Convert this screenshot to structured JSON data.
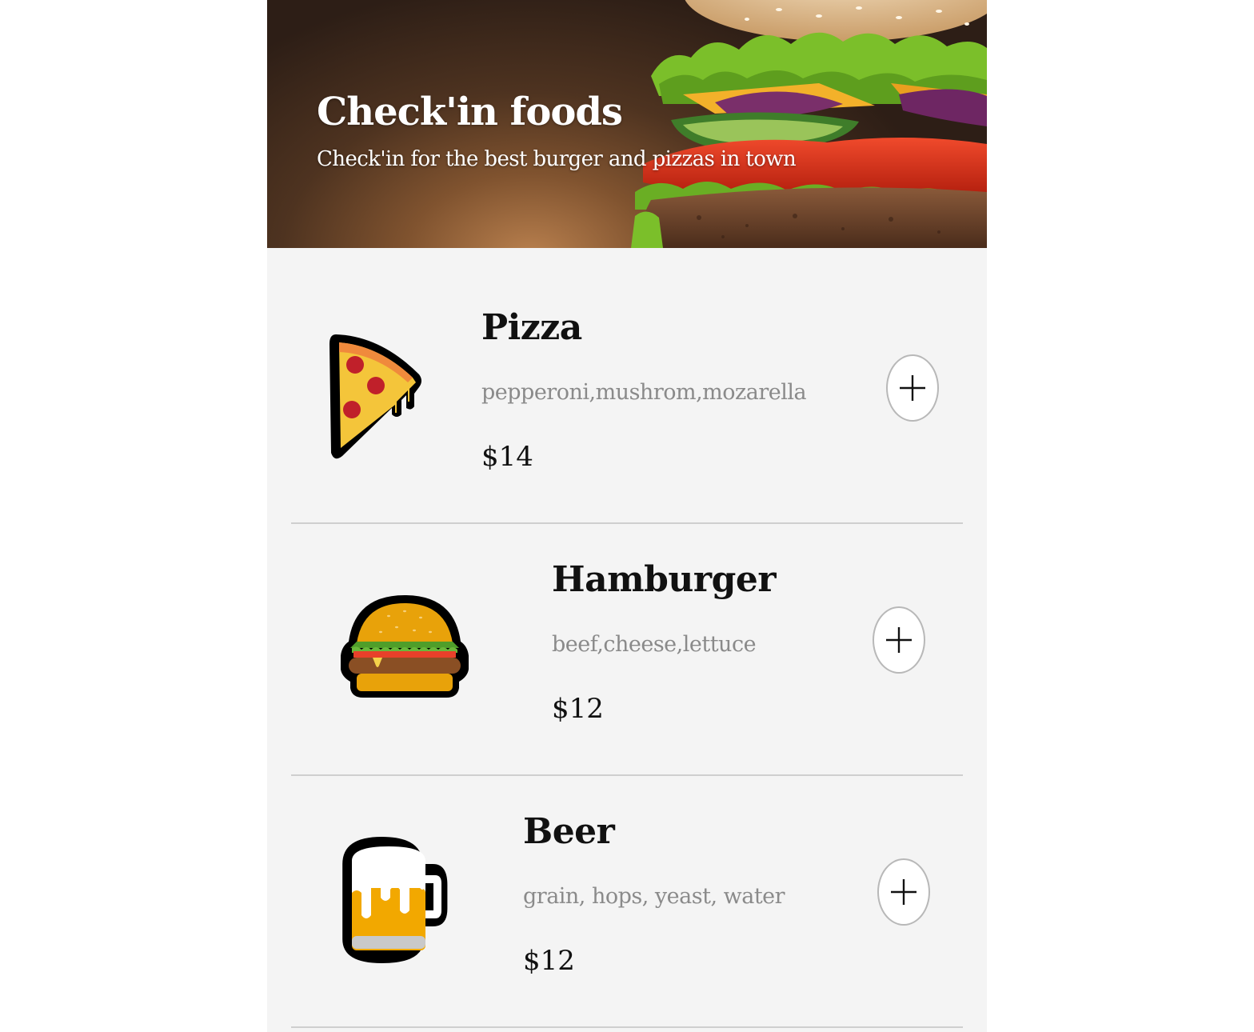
{
  "hero": {
    "title": "Check'in foods",
    "subtitle": "Check'in for the best burger and pizzas in town",
    "image": "burger-photo"
  },
  "menu": {
    "items": [
      {
        "name": "Pizza",
        "description": "pepperoni,mushrom,mozarella",
        "price": "$14",
        "icon": "pizza-icon",
        "add_icon": "plus-icon"
      },
      {
        "name": "Hamburger",
        "description": "beef,cheese,lettuce",
        "price": "$12",
        "icon": "hamburger-icon",
        "add_icon": "plus-icon"
      },
      {
        "name": "Beer",
        "description": "grain, hops, yeast, water",
        "price": "$12",
        "icon": "beer-icon",
        "add_icon": "plus-icon"
      }
    ]
  },
  "colors": {
    "background": "#f4f4f4",
    "title_text": "#111111",
    "description_text": "#8a8a8a",
    "divider": "#cfcfcf",
    "hero_text": "#ffffff"
  }
}
